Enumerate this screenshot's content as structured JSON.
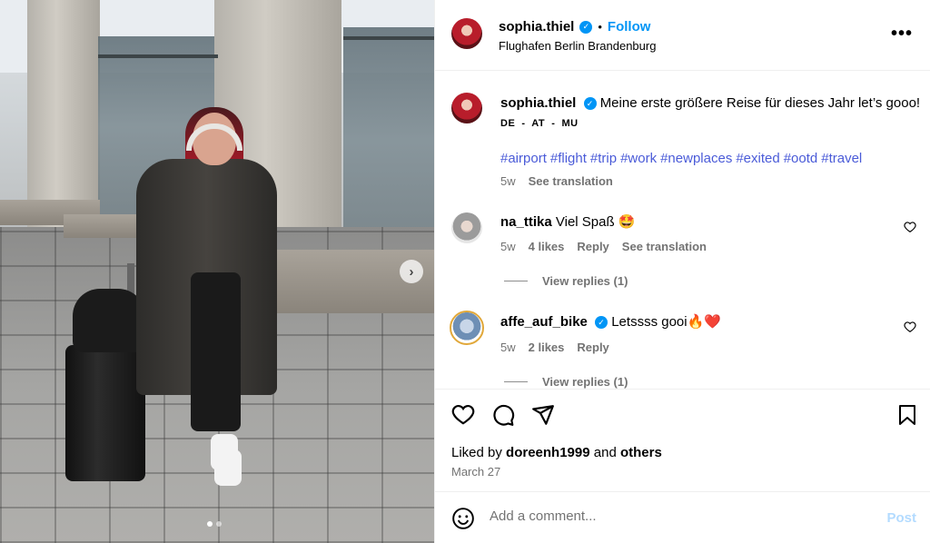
{
  "post": {
    "author": "sophia.thiel",
    "follow_label": "Follow",
    "bullet": "•",
    "location": "Flughafen Berlin Brandenburg",
    "more_label": "•••",
    "photo_alt": "Woman with red hair walking with suitcase at airport",
    "carousel_total": 2,
    "carousel_active": 1
  },
  "caption": {
    "author": "sophia.thiel",
    "text": "Meine erste größere Reise für dieses Jahr let’s gooo!",
    "subline": "DE  -  AT  -  MU",
    "hashtags": [
      "#airport",
      "#flight",
      "#trip",
      "#work",
      "#newplaces",
      "#exited",
      "#ootd",
      "#travel"
    ],
    "age": "5w",
    "see_translation": "See translation"
  },
  "comments": [
    {
      "author": "na_ttika",
      "text": "Viel Spaß 🤩",
      "age": "5w",
      "likes": "4 likes",
      "reply": "Reply",
      "see_translation": "See translation",
      "view_replies": "View replies (1)",
      "verified": false
    },
    {
      "author": "affe_auf_bike",
      "text": "Letssss gooi🔥❤️",
      "age": "5w",
      "likes": "2 likes",
      "reply": "Reply",
      "view_replies": "View replies (1)",
      "verified": true
    }
  ],
  "footer": {
    "liked_by_prefix": "Liked by",
    "liked_by_user": "doreenh1999",
    "and_text": "and",
    "others": "others",
    "date": "March 27"
  },
  "add_comment": {
    "placeholder": "Add a comment...",
    "post_label": "Post"
  },
  "colors": {
    "link_blue": "#0095f6",
    "hashtag": "#4a5bd8",
    "muted": "#737373",
    "post_disabled": "#b3dbff"
  }
}
